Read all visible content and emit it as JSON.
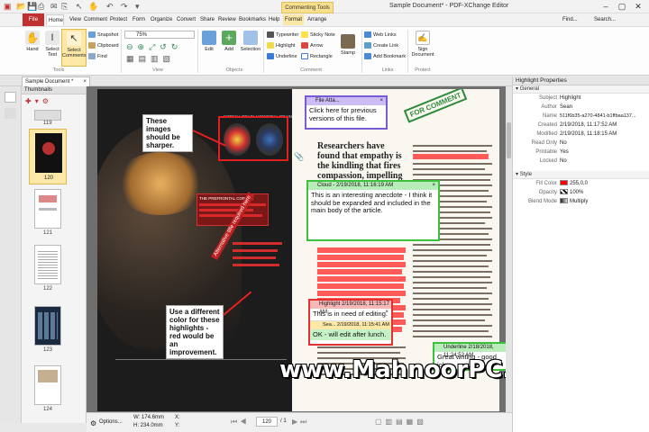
{
  "app": {
    "window_title": "Sample Document* - PDF-XChange Editor",
    "contextual_tab": "Commenting Tools",
    "find_label": "Find...",
    "search_label": "Search..."
  },
  "ribbon_tabs": [
    "File",
    "Home",
    "View",
    "Comment",
    "Protect",
    "Form",
    "Organize",
    "Convert",
    "Share",
    "Review",
    "Bookmarks",
    "Help",
    "Format",
    "Arrange"
  ],
  "ribbon": {
    "hand": "Hand",
    "select_text": "Select Text",
    "select_comments": "Select Comments",
    "snapshot": "Snapshot",
    "clipboard": "Clipboard",
    "find": "Find",
    "zoom_value": "75%",
    "edit": "Edit",
    "add": "Add",
    "selection": "Selection",
    "typewriter": "Typewriter",
    "sticky_note": "Sticky Note",
    "highlight": "Highlight",
    "arrow": "Arrow",
    "underline": "Underline",
    "rectangle": "Rectangle",
    "stamp": "Stamp",
    "web_links": "Web Links",
    "create_link": "Create Link",
    "add_bookmark": "Add Bookmark",
    "sign_document": "Sign Document",
    "groups": {
      "tools": "Tools",
      "view": "View",
      "objects": "Objects",
      "comment": "Comment",
      "links": "Links",
      "protect": "Protect"
    }
  },
  "document_tab": "Sample Document *",
  "thumbnails": {
    "title": "Thumbnails",
    "pages": [
      "119",
      "120",
      "121",
      "122",
      "123",
      "124"
    ]
  },
  "page_left": {
    "callout1": "These images should be sharper.",
    "callout2": "Use a different color for these highlights - red would be an improvement.",
    "stamp_text": "Alternative title required here",
    "label_normal": "NORMAL BRAIN",
    "label_homicidal": "HOMICIDAL BRAIN",
    "prefrontal": "THE PREFRONTAL CORTEX"
  },
  "page_right": {
    "headline": "Researchers have found that empathy is the kindling that fires compassion, impelling us to help others.",
    "stamp": "FOR COMMENT",
    "ann_file": {
      "header": "File Atta...",
      "body": "Click here for previous versions of this file."
    },
    "ann_cloud": {
      "header": "Cloud - 2/19/2018, 11:16:19 AM",
      "body": "This is an interesting anecdote - I think it should be expanded and included in the main body of the article."
    },
    "ann_highlight": {
      "header": "Highlight 2/19/2018, 11:15:17 AM",
      "body": "This is in need of editing.",
      "reply_header": "Sea... 2/19/2018, 11:15:41 AM",
      "reply_body": "OK - will edit after lunch."
    },
    "ann_underline": {
      "header": "Underline 2/18/2018, 11:24:52 AM",
      "body": "Great writing - good job."
    }
  },
  "status": {
    "options": "Options...",
    "width": "W: 174.6mm",
    "height": "H: 234.0mm",
    "x": "X:",
    "y": "Y:",
    "page": "120",
    "page_total": "/ 1"
  },
  "watermark": "www.MahnoorPC.Net",
  "properties": {
    "title": "Highlight Properties",
    "general_label": "General",
    "style_label": "Style",
    "rows": [
      {
        "key": "Subject",
        "value": "Highlight"
      },
      {
        "key": "Author",
        "value": "Sean"
      },
      {
        "key": "Name",
        "value": "511f6b35-a270-4841-b1ffbaa137..."
      },
      {
        "key": "Created",
        "value": "2/19/2018, 11:17:52 AM"
      },
      {
        "key": "Modified",
        "value": "2/19/2018, 11:18:15 AM"
      },
      {
        "key": "Read Only",
        "value": "No"
      },
      {
        "key": "Printable",
        "value": "Yes"
      },
      {
        "key": "Locked",
        "value": "No"
      }
    ],
    "style_rows": [
      {
        "key": "Fill Color",
        "value": "255,0,0"
      },
      {
        "key": "Opacity",
        "value": "100%"
      },
      {
        "key": "Blend Mode",
        "value": "Multiply"
      }
    ],
    "fill_color_hex": "#ff0000"
  },
  "colors": {
    "file_tab": "#c03030",
    "contextual": "#f9e08f",
    "ann_purple": "#7a5bd6",
    "ann_green": "#3cc23c",
    "ann_red": "#e33030",
    "highlight_red": "#ff2525"
  }
}
